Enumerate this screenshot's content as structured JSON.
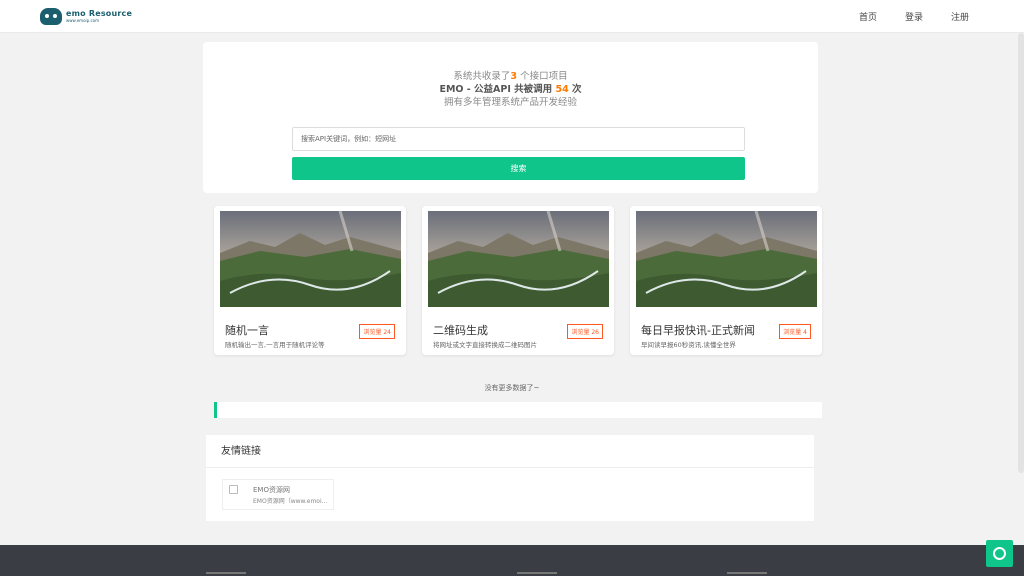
{
  "header": {
    "logo_main": "emo Resource",
    "logo_sub": "www.emoip.com",
    "nav": [
      "首页",
      "登录",
      "注册"
    ]
  },
  "hero": {
    "line1_prefix": "系统共收录了",
    "line1_count": "3",
    "line1_suffix": " 个接口项目",
    "line2_prefix": "EMO - 公益API 共被调用 ",
    "line2_count": "54",
    "line2_suffix": " 次",
    "line3": "拥有多年管理系统产品开发经验",
    "search_placeholder": "搜索API关键词，例如：短网址",
    "search_button": "搜索"
  },
  "cards": [
    {
      "title": "随机一言",
      "desc": "随机输出一言,一言用于随机评论等",
      "badge": "浏览量 24"
    },
    {
      "title": "二维码生成",
      "desc": "将网址或文字直接转换成二维码图片",
      "badge": "浏览量 26"
    },
    {
      "title": "每日早报快讯-正式新闻",
      "desc": "早间读早报60秒资讯,读懂全世界",
      "badge": "浏览量 4"
    }
  ],
  "no_more": "没有更多数据了~",
  "friend_links": {
    "heading": "友情链接",
    "items": [
      {
        "name": "EMO资源网",
        "desc": "EMO资源网（www.emoip.com）"
      }
    ]
  },
  "colors": {
    "accent": "#10c58a",
    "highlight": "#ff7a00",
    "badge": "#ff5722",
    "footer": "#3a3d44"
  }
}
